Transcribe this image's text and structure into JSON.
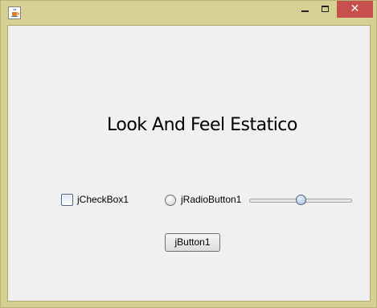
{
  "window": {
    "title": "",
    "icon": "java-cup-icon",
    "controls": {
      "minimize_icon": "minimize-icon",
      "maximize_icon": "maximize-icon",
      "close_label": "✕"
    },
    "frame_color": "#d6d193",
    "close_color": "#c74f4c"
  },
  "main": {
    "title": "Look And Feel Estatico",
    "checkbox": {
      "label": "jCheckBox1",
      "checked": false
    },
    "radio": {
      "label": "jRadioButton1",
      "selected": false
    },
    "slider": {
      "value": 50,
      "min": 0,
      "max": 100
    },
    "button": {
      "label": "jButton1"
    }
  }
}
